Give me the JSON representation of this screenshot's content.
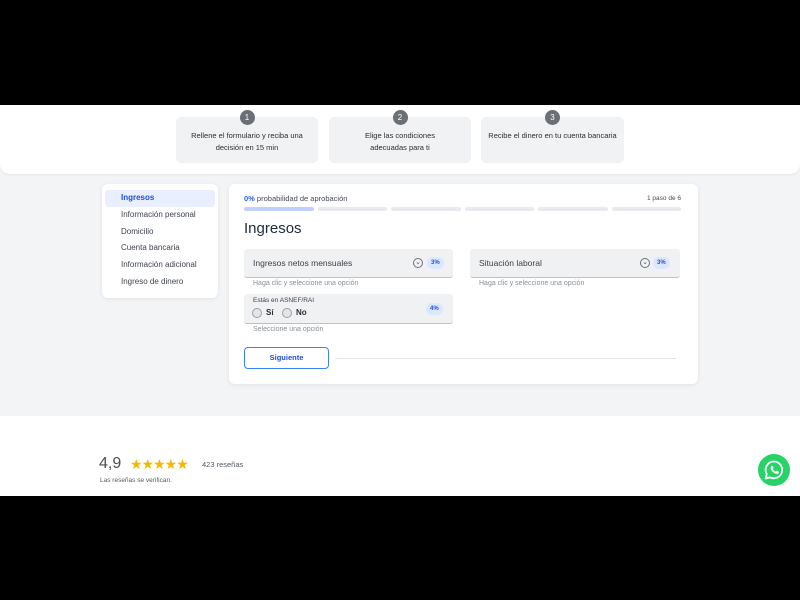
{
  "steps": [
    {
      "number": "1",
      "text": "Rellene el formulario y reciba una decisión en 15 min"
    },
    {
      "number": "2",
      "text": "Elige las condiciones adecuadas para ti"
    },
    {
      "number": "3",
      "text": "Recibe el dinero en tu cuenta bancaria"
    }
  ],
  "sidebar": {
    "items": [
      {
        "label": "Ingresos",
        "active": true
      },
      {
        "label": "Información personal"
      },
      {
        "label": "Domicilio"
      },
      {
        "label": "Cuenta bancaria"
      },
      {
        "label": "Información adicional"
      },
      {
        "label": "Ingreso de dinero"
      }
    ]
  },
  "form": {
    "probability_pct": "0%",
    "probability_text": " probabilidad de aprobación",
    "step_counter": "1 paso de 6",
    "progress": {
      "current_step": 1,
      "total_steps": 6
    },
    "title": "Ingresos",
    "fields": {
      "net_income": {
        "label": "Ingresos netos mensuales",
        "badge": "3%",
        "hint": "Haga clic y seleccione una opción"
      },
      "employment": {
        "label": "Situación laboral",
        "badge": "3%",
        "hint": "Haga clic y seleccione una opción"
      },
      "asnef": {
        "question": "Estás en ASNEF/RAI",
        "yes": "Sí",
        "no": "No",
        "badge": "4%",
        "hint": "Seleccione una opción"
      }
    },
    "next_button": "Siguiente"
  },
  "reviews": {
    "score": "4,9",
    "stars": "★★★★★",
    "count": "423 reseñas",
    "note": "Las reseñas se verifican."
  },
  "colors": {
    "accent": "#2563eb",
    "star": "#f5b800",
    "whatsapp": "#25d366"
  },
  "icons": {
    "chevron": "chevron-down-icon",
    "whatsapp": "whatsapp-icon"
  }
}
